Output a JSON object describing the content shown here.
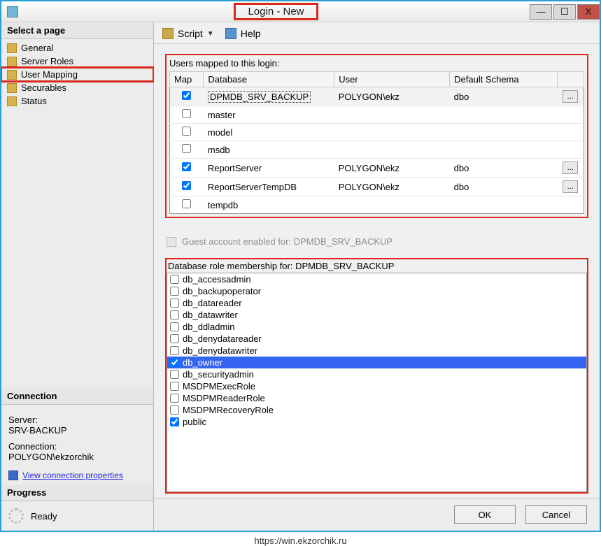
{
  "window": {
    "title": "Login - New"
  },
  "titlebar": {
    "min": "—",
    "max": "☐",
    "close": "X"
  },
  "sidebar": {
    "header": "Select a page",
    "items": [
      {
        "label": "General"
      },
      {
        "label": "Server Roles"
      },
      {
        "label": "User Mapping",
        "selected": true
      },
      {
        "label": "Securables"
      },
      {
        "label": "Status"
      }
    ]
  },
  "connection": {
    "header": "Connection",
    "server_label": "Server:",
    "server_value": "SRV-BACKUP",
    "connection_label": "Connection:",
    "connection_value": "POLYGON\\ekzorchik",
    "link": "View connection properties"
  },
  "progress": {
    "header": "Progress",
    "status": "Ready"
  },
  "toolbar": {
    "script": "Script",
    "help": "Help"
  },
  "mapping": {
    "label": "Users mapped to this login:",
    "columns": {
      "map": "Map",
      "database": "Database",
      "user": "User",
      "schema": "Default Schema"
    },
    "rows": [
      {
        "checked": true,
        "database": "DPMDB_SRV_BACKUP",
        "user": "POLYGON\\ekz",
        "schema": "dbo",
        "btn": true,
        "selected": true
      },
      {
        "checked": false,
        "database": "master",
        "user": "",
        "schema": ""
      },
      {
        "checked": false,
        "database": "model",
        "user": "",
        "schema": ""
      },
      {
        "checked": false,
        "database": "msdb",
        "user": "",
        "schema": ""
      },
      {
        "checked": true,
        "database": "ReportServer",
        "user": "POLYGON\\ekz",
        "schema": "dbo",
        "btn": true
      },
      {
        "checked": true,
        "database": "ReportServerTempDB",
        "user": "POLYGON\\ekz",
        "schema": "dbo",
        "btn": true
      },
      {
        "checked": false,
        "database": "tempdb",
        "user": "",
        "schema": ""
      }
    ]
  },
  "guest": {
    "label": "Guest account enabled for: DPMDB_SRV_BACKUP"
  },
  "roles": {
    "label": "Database role membership for: DPMDB_SRV_BACKUP",
    "items": [
      {
        "name": "db_accessadmin",
        "checked": false
      },
      {
        "name": "db_backupoperator",
        "checked": false
      },
      {
        "name": "db_datareader",
        "checked": false
      },
      {
        "name": "db_datawriter",
        "checked": false
      },
      {
        "name": "db_ddladmin",
        "checked": false
      },
      {
        "name": "db_denydatareader",
        "checked": false
      },
      {
        "name": "db_denydatawriter",
        "checked": false
      },
      {
        "name": "db_owner",
        "checked": true,
        "selected": true
      },
      {
        "name": "db_securityadmin",
        "checked": false
      },
      {
        "name": "MSDPMExecRole",
        "checked": false
      },
      {
        "name": "MSDPMReaderRole",
        "checked": false
      },
      {
        "name": "MSDPMRecoveryRole",
        "checked": false
      },
      {
        "name": "public",
        "checked": true
      }
    ]
  },
  "footer": {
    "ok": "OK",
    "cancel": "Cancel"
  },
  "source": "https://win.ekzorchik.ru"
}
